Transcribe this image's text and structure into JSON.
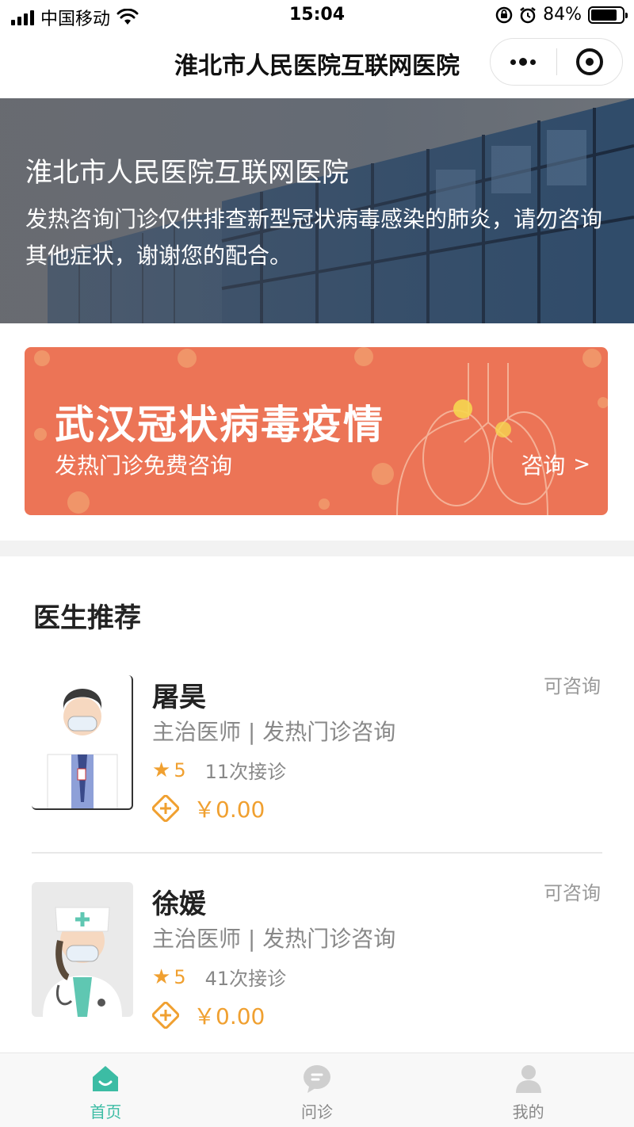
{
  "status_bar": {
    "carrier": "中国移动",
    "time": "15:04",
    "battery": "84%",
    "battery_level": 0.84
  },
  "nav": {
    "title": "淮北市人民医院互联网医院"
  },
  "hero": {
    "title": "淮北市人民医院互联网医院",
    "description": "发热咨询门诊仅供排查新型冠状病毒感染的肺炎，请勿咨询其他症状，谢谢您的配合。"
  },
  "banner": {
    "title": "武汉冠状病毒疫情",
    "subtitle": "发热门诊免费咨询",
    "cta": "咨询",
    "cta_arrow": ">"
  },
  "section": {
    "title": "医生推荐"
  },
  "doctors": [
    {
      "name": "屠昊",
      "title": "主治医师 | 发热门诊咨询",
      "rating": "5",
      "consults": "11次接诊",
      "price": "￥0.00",
      "status": "可咨询"
    },
    {
      "name": "徐媛",
      "title": "主治医师 | 发热门诊咨询",
      "rating": "5",
      "consults": "41次接诊",
      "price": "￥0.00",
      "status": "可咨询"
    }
  ],
  "tabs": [
    {
      "label": "首页",
      "icon": "home-icon",
      "active": true
    },
    {
      "label": "问诊",
      "icon": "chat-bubble-icon",
      "active": false
    },
    {
      "label": "我的",
      "icon": "user-icon",
      "active": false
    }
  ],
  "colors": {
    "accent": "#3cbca4",
    "banner": "#ec7456",
    "price": "#f0a030"
  }
}
